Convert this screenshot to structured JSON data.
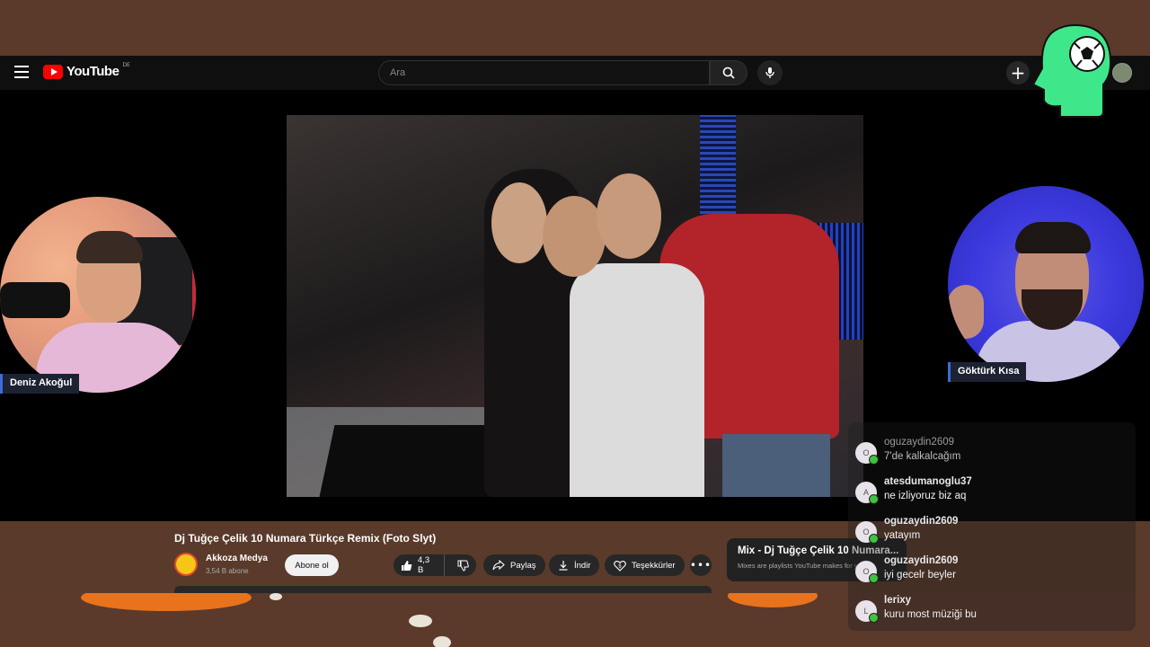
{
  "youtube": {
    "logo_text": "YouTube",
    "region": "DE",
    "search_placeholder": "Ara",
    "video": {
      "title": "Dj Tuğçe Çelik 10 Numara Türkçe Remix (Foto Slyt)"
    },
    "channel": {
      "name": "Akkoza Medya",
      "subscribers": "3,54 B abone",
      "subscribe_label": "Abone ol"
    },
    "actions": {
      "like_count": "4,3 B",
      "share_label": "Paylaş",
      "download_label": "İndir",
      "thanks_label": "Teşekkürler",
      "more_label": "•••"
    },
    "mix_card": {
      "title": "Mix - Dj Tuğçe Çelik 10 Numara...",
      "subtitle": "Mixes are playlists YouTube makes for you"
    }
  },
  "streamers": {
    "left_name": "Deniz Akoğul",
    "right_name": "Göktürk Kısa"
  },
  "chat": [
    {
      "initial": "O",
      "user": "oguzaydin2609",
      "text": "7'de kalkalcağım",
      "dim": true
    },
    {
      "initial": "A",
      "user": "atesdumanoglu37",
      "text": "ne izliyoruz biz aq",
      "dim": false
    },
    {
      "initial": "O",
      "user": "oguzaydin2609",
      "text": "yatayım",
      "dim": false
    },
    {
      "initial": "O",
      "user": "oguzaydin2609",
      "text": "iyi gecelr beyler",
      "dim": false
    },
    {
      "initial": "L",
      "user": "lerixy",
      "text": "kuru most müziği bu",
      "dim": false
    }
  ],
  "colors": {
    "youtube_red": "#ff0000",
    "brand_green": "#3ee88a",
    "background_brown": "#5b3a2b",
    "pumpkin_orange": "#e8731c"
  }
}
